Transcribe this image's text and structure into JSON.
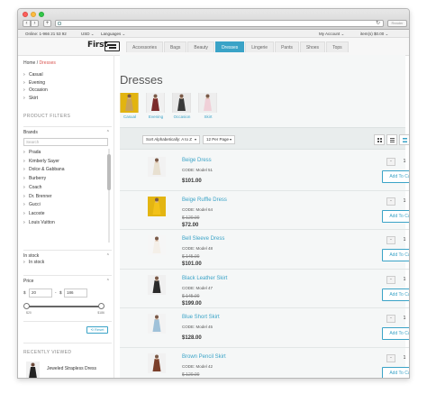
{
  "browser": {
    "reload_glyph": "↻",
    "reader_label": "Reader"
  },
  "topbar": {
    "online": "Online: 1-966 21 53 92",
    "currency": "USD ⌄",
    "language": "Languages ⌄",
    "account": "My Account ⌄",
    "cart": "item(s) $0.00 ⌄"
  },
  "header": {
    "logo": "First",
    "menu": [
      "Accessories",
      "Bags",
      "Beauty",
      "Dresses",
      "Lingerie",
      "Pants",
      "Shoes",
      "Tops"
    ],
    "active_menu": "Dresses"
  },
  "sidebar": {
    "breadcrumb_home": "Home",
    "breadcrumb_sep": "/",
    "breadcrumb_current": "Dresses",
    "categories": [
      "Casual",
      "Evening",
      "Occasion",
      "Skirt"
    ],
    "filters_title": "PRODUCT FILTERS",
    "brands_title": "Brands",
    "brand_search_placeholder": "Search",
    "brands": [
      "Prada",
      "Kimberly Sayer",
      "Dolce & Gabbana",
      "Burberry",
      "Coach",
      "Dr. Brenner",
      "Gucci",
      "Lacoste",
      "Louis Vuitton"
    ],
    "instock_title": "In stock",
    "instock_option": "In stock",
    "price_title": "Price",
    "currency_symbol": "$",
    "price_min": "20",
    "price_dash": "-",
    "price_max": "186",
    "slider_min_label": "$20",
    "slider_max_label": "$186",
    "reset_label": "Reset",
    "recent_title": "RECENTLY VIEWED",
    "recent_item": "Jeweled Strapless Dress"
  },
  "main": {
    "title": "Dresses",
    "subcategories": [
      "Casual",
      "Evening",
      "Occasion",
      "Skirt"
    ],
    "sort_value": "Sort Alphabetically: A to Z",
    "perpage_value": "12 Per Page",
    "dropdown_glyph": "▾"
  },
  "products": [
    {
      "name": "Beige Dress",
      "code": "CODE: Model 51",
      "old_price": "",
      "price": "$101.00",
      "qty": "1"
    },
    {
      "name": "Beige Ruffle Dress",
      "code": "CODE: Model 64",
      "old_price": "$ 120.00",
      "price": "$72.00",
      "qty": "1"
    },
    {
      "name": "Bell Sleeve Dress",
      "code": "CODE: Model 48",
      "old_price": "$ 145.00",
      "price": "$101.00",
      "qty": "1"
    },
    {
      "name": "Black Leather Skirt",
      "code": "CODE: Model 47",
      "old_price": "$ 145.00",
      "price": "$199.00",
      "qty": "1"
    },
    {
      "name": "Blue Short Skirt",
      "code": "CODE: Model 45",
      "old_price": "",
      "price": "$128.00",
      "qty": "1"
    },
    {
      "name": "Brown Pencil Skirt",
      "code": "CODE: Model 42",
      "old_price": "$ 120.00",
      "price": "$99.00",
      "qty": "1"
    }
  ],
  "labels": {
    "add_to_cart": "Add To Cart",
    "minus": "-",
    "plus": "+"
  },
  "colors": {
    "accent": "#3aa3c7",
    "breadcrumb_current": "#d9534f",
    "subcat_bg": [
      "#e2b410",
      "#f0f0f0",
      "#e9e9e9",
      "#eeeeee"
    ],
    "dress": [
      "#e8e0d0",
      "#f2c21a",
      "#f4efe8",
      "#2b2b2b",
      "#9fc1d9",
      "#7a3f2a"
    ]
  }
}
